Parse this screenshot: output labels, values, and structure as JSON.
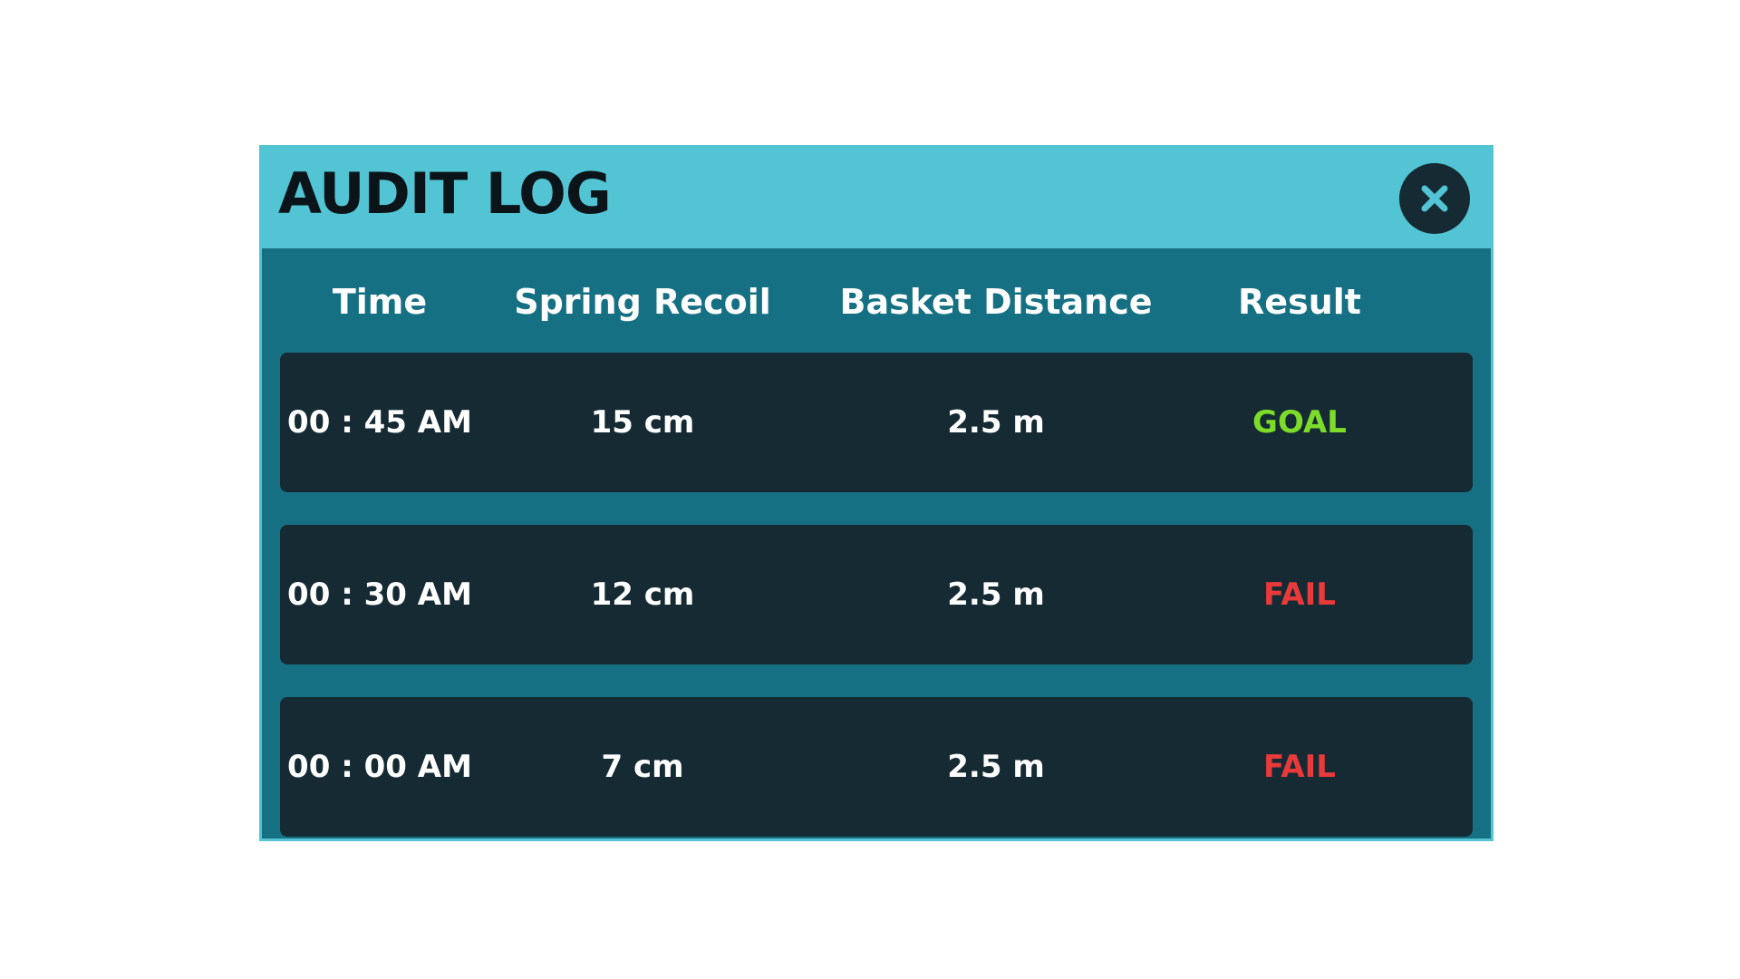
{
  "dialog": {
    "title": "AUDIT LOG",
    "close_icon": "close-icon",
    "colors": {
      "header_bg": "#52c4d4",
      "panel_bg": "#167083",
      "row_bg": "#152a33",
      "goal": "#7ddc2a",
      "fail": "#e8393b"
    }
  },
  "table": {
    "columns": [
      "Time",
      "Spring Recoil",
      "Basket Distance",
      "Result"
    ],
    "rows": [
      {
        "time": "00 : 45 AM",
        "recoil": "15 cm",
        "distance": "2.5 m",
        "result": "GOAL",
        "status": "goal"
      },
      {
        "time": "00 : 30 AM",
        "recoil": "12 cm",
        "distance": "2.5 m",
        "result": "FAIL",
        "status": "fail"
      },
      {
        "time": "00 : 00 AM",
        "recoil": "7 cm",
        "distance": "2.5 m",
        "result": "FAIL",
        "status": "fail"
      }
    ]
  }
}
